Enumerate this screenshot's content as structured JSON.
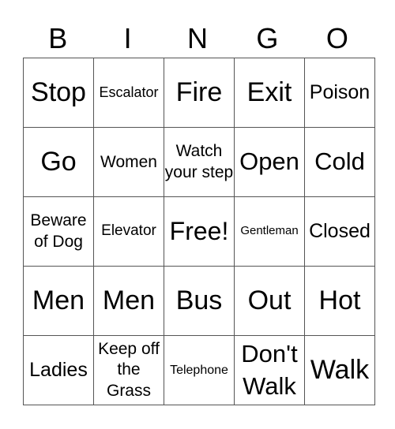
{
  "header": [
    "B",
    "I",
    "N",
    "G",
    "O"
  ],
  "rows": [
    [
      "Stop",
      "Escalator",
      "Fire",
      "Exit",
      "Poison"
    ],
    [
      "Go",
      "Women",
      "Watch your step",
      "Open",
      "Cold"
    ],
    [
      "Beware of Dog",
      "Elevator",
      "Free!",
      "Gentleman",
      "Closed"
    ],
    [
      "Men",
      "Men",
      "Bus",
      "Out",
      "Hot"
    ],
    [
      "Ladies",
      "Keep off the Grass",
      "Telephone",
      "Don't Walk",
      "Walk"
    ]
  ]
}
